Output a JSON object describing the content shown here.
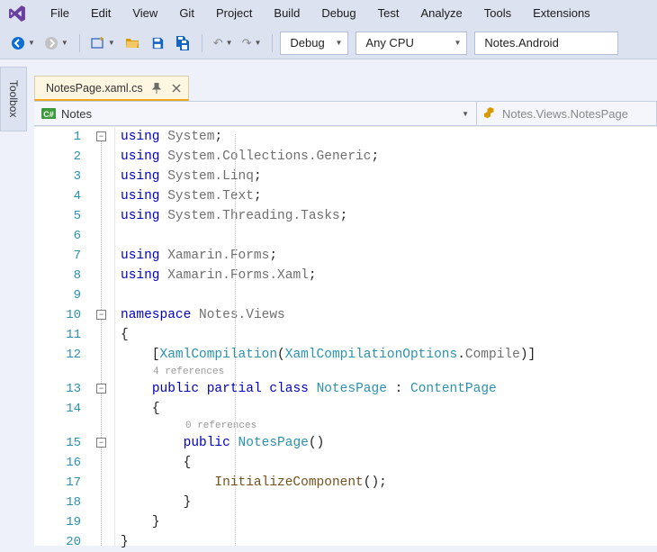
{
  "menu": {
    "items": [
      "File",
      "Edit",
      "View",
      "Git",
      "Project",
      "Build",
      "Debug",
      "Test",
      "Analyze",
      "Tools",
      "Extensions"
    ]
  },
  "toolbar": {
    "debug_label": "Debug",
    "platform_label": "Any CPU",
    "target_label": "Notes.Android"
  },
  "side_tab": {
    "label": "Toolbox"
  },
  "doc_tab": {
    "label": "NotesPage.xaml.cs"
  },
  "nav": {
    "left_icon": "csharp-icon",
    "left_label": "Notes",
    "right_icon": "class-icon",
    "right_label": "Notes.Views.NotesPage"
  },
  "refs": {
    "class_refs": "4 references",
    "ctor_refs": "0 references"
  },
  "code": {
    "lines": [
      {
        "n": 1,
        "tokens": [
          [
            "kw",
            "using"
          ],
          [
            "sp",
            " "
          ],
          [
            "ns",
            "System"
          ],
          [
            "pun",
            ";"
          ]
        ]
      },
      {
        "n": 2,
        "tokens": [
          [
            "kw",
            "using"
          ],
          [
            "sp",
            " "
          ],
          [
            "ns",
            "System.Collections.Generic"
          ],
          [
            "pun",
            ";"
          ]
        ]
      },
      {
        "n": 3,
        "tokens": [
          [
            "kw",
            "using"
          ],
          [
            "sp",
            " "
          ],
          [
            "ns",
            "System.Linq"
          ],
          [
            "pun",
            ";"
          ]
        ]
      },
      {
        "n": 4,
        "tokens": [
          [
            "kw",
            "using"
          ],
          [
            "sp",
            " "
          ],
          [
            "ns",
            "System.Text"
          ],
          [
            "pun",
            ";"
          ]
        ]
      },
      {
        "n": 5,
        "tokens": [
          [
            "kw",
            "using"
          ],
          [
            "sp",
            " "
          ],
          [
            "ns",
            "System.Threading.Tasks"
          ],
          [
            "pun",
            ";"
          ]
        ]
      },
      {
        "n": 6,
        "tokens": []
      },
      {
        "n": 7,
        "tokens": [
          [
            "kw",
            "using"
          ],
          [
            "sp",
            " "
          ],
          [
            "ns",
            "Xamarin.Forms"
          ],
          [
            "pun",
            ";"
          ]
        ]
      },
      {
        "n": 8,
        "tokens": [
          [
            "kw",
            "using"
          ],
          [
            "sp",
            " "
          ],
          [
            "ns",
            "Xamarin.Forms.Xaml"
          ],
          [
            "pun",
            ";"
          ]
        ]
      },
      {
        "n": 9,
        "tokens": []
      },
      {
        "n": 10,
        "tokens": [
          [
            "kw",
            "namespace"
          ],
          [
            "sp",
            " "
          ],
          [
            "ns",
            "Notes.Views"
          ]
        ]
      },
      {
        "n": 11,
        "tokens": [
          [
            "pun",
            "{"
          ]
        ]
      },
      {
        "n": 12,
        "tokens": [
          [
            "sp",
            "    "
          ],
          [
            "pun",
            "["
          ],
          [
            "attr",
            "XamlCompilation"
          ],
          [
            "pun",
            "("
          ],
          [
            "type",
            "XamlCompilationOptions"
          ],
          [
            "pun",
            "."
          ],
          [
            "ns",
            "Compile"
          ],
          [
            "pun",
            ")]"
          ]
        ]
      },
      {
        "n": 13,
        "tokens": [
          [
            "sp",
            "    "
          ],
          [
            "kw",
            "public"
          ],
          [
            "sp",
            " "
          ],
          [
            "kw",
            "partial"
          ],
          [
            "sp",
            " "
          ],
          [
            "kw",
            "class"
          ],
          [
            "sp",
            " "
          ],
          [
            "type",
            "NotesPage"
          ],
          [
            "sp",
            " "
          ],
          [
            "pun",
            ":"
          ],
          [
            "sp",
            " "
          ],
          [
            "type",
            "ContentPage"
          ]
        ]
      },
      {
        "n": 14,
        "tokens": [
          [
            "sp",
            "    "
          ],
          [
            "pun",
            "{"
          ]
        ]
      },
      {
        "n": 15,
        "tokens": [
          [
            "sp",
            "        "
          ],
          [
            "kw",
            "public"
          ],
          [
            "sp",
            " "
          ],
          [
            "type",
            "NotesPage"
          ],
          [
            "pun",
            "()"
          ]
        ]
      },
      {
        "n": 16,
        "tokens": [
          [
            "sp",
            "        "
          ],
          [
            "pun",
            "{"
          ]
        ]
      },
      {
        "n": 17,
        "tokens": [
          [
            "sp",
            "            "
          ],
          [
            "meth",
            "InitializeComponent"
          ],
          [
            "pun",
            "();"
          ]
        ]
      },
      {
        "n": 18,
        "tokens": [
          [
            "sp",
            "        "
          ],
          [
            "pun",
            "}"
          ]
        ]
      },
      {
        "n": 19,
        "tokens": [
          [
            "sp",
            "    "
          ],
          [
            "pun",
            "}"
          ]
        ]
      },
      {
        "n": 20,
        "tokens": [
          [
            "pun",
            "}"
          ]
        ]
      }
    ]
  }
}
